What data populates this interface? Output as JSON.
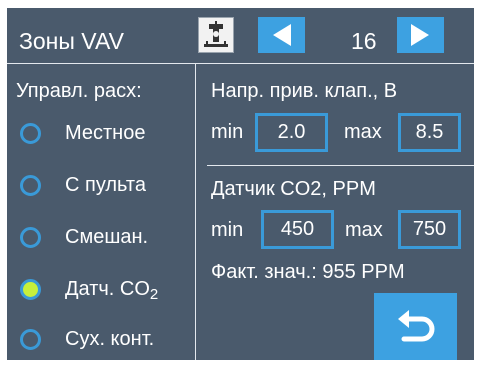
{
  "header": {
    "title": "Зоны VAV",
    "zone_number": "16"
  },
  "flow_control": {
    "label": "Управл. расх:",
    "options": [
      {
        "label": "Местное",
        "selected": false
      },
      {
        "label": "С пульта",
        "selected": false
      },
      {
        "label": "Смешан.",
        "selected": false
      },
      {
        "label": "Датч. CO",
        "sub": "2",
        "selected": true
      },
      {
        "label": "Сух. конт.",
        "selected": false
      }
    ]
  },
  "damper": {
    "title": "Напр. прив. клап., В",
    "min_label": "min",
    "min_value": "2.0",
    "max_label": "max",
    "max_value": "8.5"
  },
  "co2": {
    "title": "Датчик CO2, PPM",
    "min_label": "min",
    "min_value": "450",
    "max_label": "max",
    "max_value": "750",
    "actual": "Факт. знач.: 955 PPM"
  },
  "colors": {
    "background": "#4a5a6c",
    "accent": "#3da1e1",
    "radio_selected": "#c7f03c"
  },
  "icons": {
    "settings": "damper-actuator-icon",
    "prev": "arrow-left-icon",
    "next": "arrow-right-icon",
    "back": "return-arrow-icon"
  }
}
